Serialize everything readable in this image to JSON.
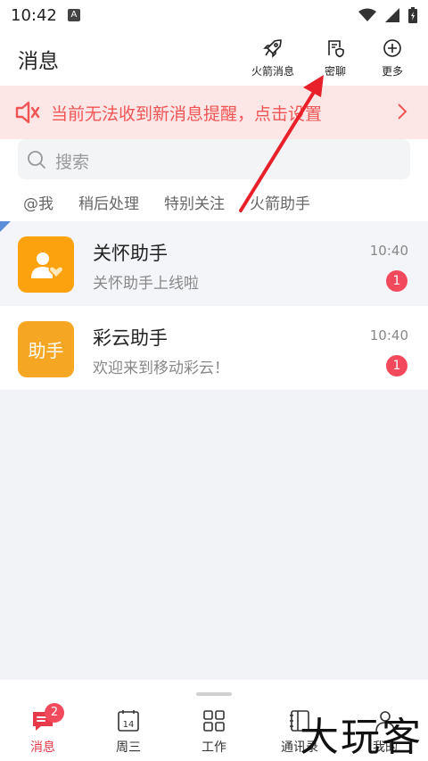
{
  "status": {
    "time": "10:42",
    "indicator": "A"
  },
  "header": {
    "title": "消息",
    "actions": [
      {
        "icon": "rocket-icon",
        "label": "火箭消息"
      },
      {
        "icon": "secret-chat-icon",
        "label": "密聊"
      },
      {
        "icon": "plus-circle-icon",
        "label": "更多"
      }
    ]
  },
  "banner": {
    "text": "当前无法收到新消息提醒，点击设置"
  },
  "search": {
    "placeholder": "搜索"
  },
  "filters": [
    "@我",
    "稍后处理",
    "特别关注",
    "火箭助手"
  ],
  "chats": [
    {
      "name": "关怀助手",
      "preview": "关怀助手上线啦",
      "time": "10:40",
      "unread": "1",
      "avatar_color": "#fda20f",
      "pinned": true
    },
    {
      "name": "彩云助手",
      "preview": "欢迎来到移动彩云！",
      "time": "10:40",
      "unread": "1",
      "avatar_color": "#f5a623",
      "avatar_text": "助手",
      "pinned": false
    }
  ],
  "nav": {
    "items": [
      {
        "label": "消息",
        "badge": "2"
      },
      {
        "label": "周三",
        "calendar_day": "14"
      },
      {
        "label": "工作"
      },
      {
        "label": "通讯录"
      },
      {
        "label": "我的"
      }
    ]
  },
  "colors": {
    "accent": "#e6394a",
    "banner_text": "#f05555",
    "banner_bg": "#fde6e6",
    "annotation_arrow": "#e8202a"
  },
  "watermark": "大玩客"
}
